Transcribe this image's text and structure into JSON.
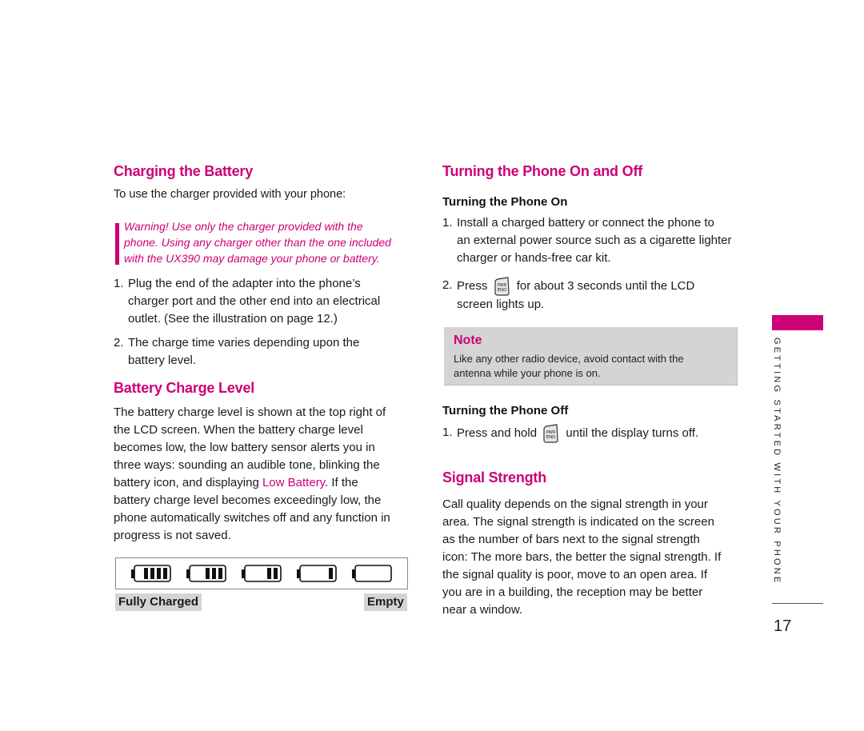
{
  "left": {
    "charging": {
      "title": "Charging the Battery",
      "intro": "To use the charger provided with your phone:",
      "warning_lines": [
        "Warning! Use only the charger provided with the",
        "phone. Using any charger other than the one included",
        "with the UX390 may damage your phone or battery."
      ],
      "steps": [
        {
          "num": "1.",
          "lines": [
            "Plug the end of the adapter into the phone’s",
            "charger port and the other end into an electrical",
            "outlet. (See the illustration on page 12.)"
          ]
        },
        {
          "num": "2.",
          "lines": [
            "The charge time varies depending upon the",
            "battery level."
          ]
        }
      ]
    },
    "battery_level": {
      "title": "Battery Charge Level",
      "lines": [
        "The battery charge level is shown at the top right of",
        "the LCD screen. When the battery charge level",
        "becomes low, the low battery sensor alerts you in",
        "three ways: sounding an audible tone, blinking the"
      ],
      "line5_pre": "battery icon, and displaying ",
      "line5_highlight": "Low Battery",
      "line5_post": ". If the",
      "lines_after": [
        "battery charge level becomes exceedingly low, the",
        "phone automatically switches off and any function in",
        "progress is not saved."
      ],
      "icons": [
        {
          "name": "battery-full-icon",
          "bars": 4
        },
        {
          "name": "battery-three-quarter-icon",
          "bars": 3
        },
        {
          "name": "battery-half-icon",
          "bars": 2
        },
        {
          "name": "battery-low-icon",
          "bars": 1
        },
        {
          "name": "battery-empty-icon",
          "bars": 0
        }
      ],
      "label_full": "Fully Charged",
      "label_empty": "Empty"
    }
  },
  "right": {
    "on_off": {
      "title": "Turning the Phone On and Off",
      "on_subtitle": "Turning the Phone On",
      "on_step1_num": "1.",
      "on_step1_lines": [
        "Install a charged battery or connect the phone to",
        "an external power source such as a cigarette lighter",
        "charger or hands-free car kit."
      ],
      "on_step2_num": "2.",
      "on_step2_pre": "Press",
      "on_step2_post": "for about 3 seconds until the LCD",
      "on_step2_line2": "screen lights up.",
      "key_label_top": "PWR",
      "key_label_bottom": "END",
      "note_title": "Note",
      "note_lines": [
        "Like any other radio device, avoid contact with the",
        "antenna while your phone is on."
      ],
      "off_subtitle": "Turning the Phone Off",
      "off_step1_num": "1.",
      "off_step1_pre": "Press and hold",
      "off_step1_post": "until the display turns off."
    },
    "signal": {
      "title": "Signal Strength",
      "lines": [
        "Call quality depends on the signal strength in your",
        "area. The signal strength is indicated on the screen",
        "as the number of bars next to the signal strength",
        "icon: The more bars, the better the signal strength. If",
        "the signal quality is poor, move to an open area. If",
        "you are in a building, the reception may be better",
        "near a window."
      ]
    }
  },
  "side": {
    "section_label": "GETTING STARTED WITH YOUR PHONE",
    "page_number": "17",
    "accent_color": "#cc0077"
  }
}
